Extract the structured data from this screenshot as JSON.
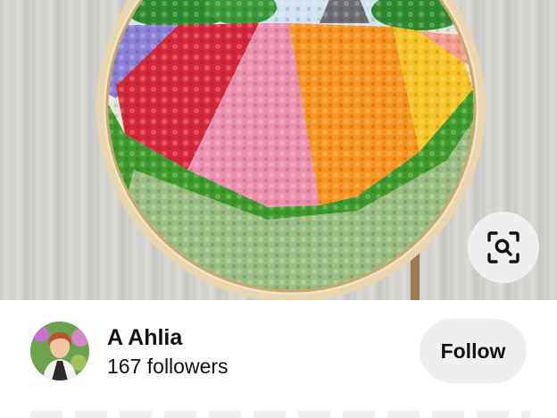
{
  "pin": {
    "image_subject": "embroidery-hoop-flower-field",
    "colors": {
      "wood": "#d4d4d1",
      "hoop": "#e9cf9f",
      "purple": "#8a7fd6",
      "red": "#d6263a",
      "pink": "#ec8fae",
      "orange": "#f7941d",
      "yellow": "#f6c325",
      "grass": "#3e9a2a",
      "trees": "#2f8b2f"
    }
  },
  "visual_search": {
    "icon": "lens-icon"
  },
  "creator": {
    "name": "A Ahlia",
    "followers": "167 followers",
    "avatar_icon": "avatar"
  },
  "follow": {
    "label": "Follow"
  }
}
